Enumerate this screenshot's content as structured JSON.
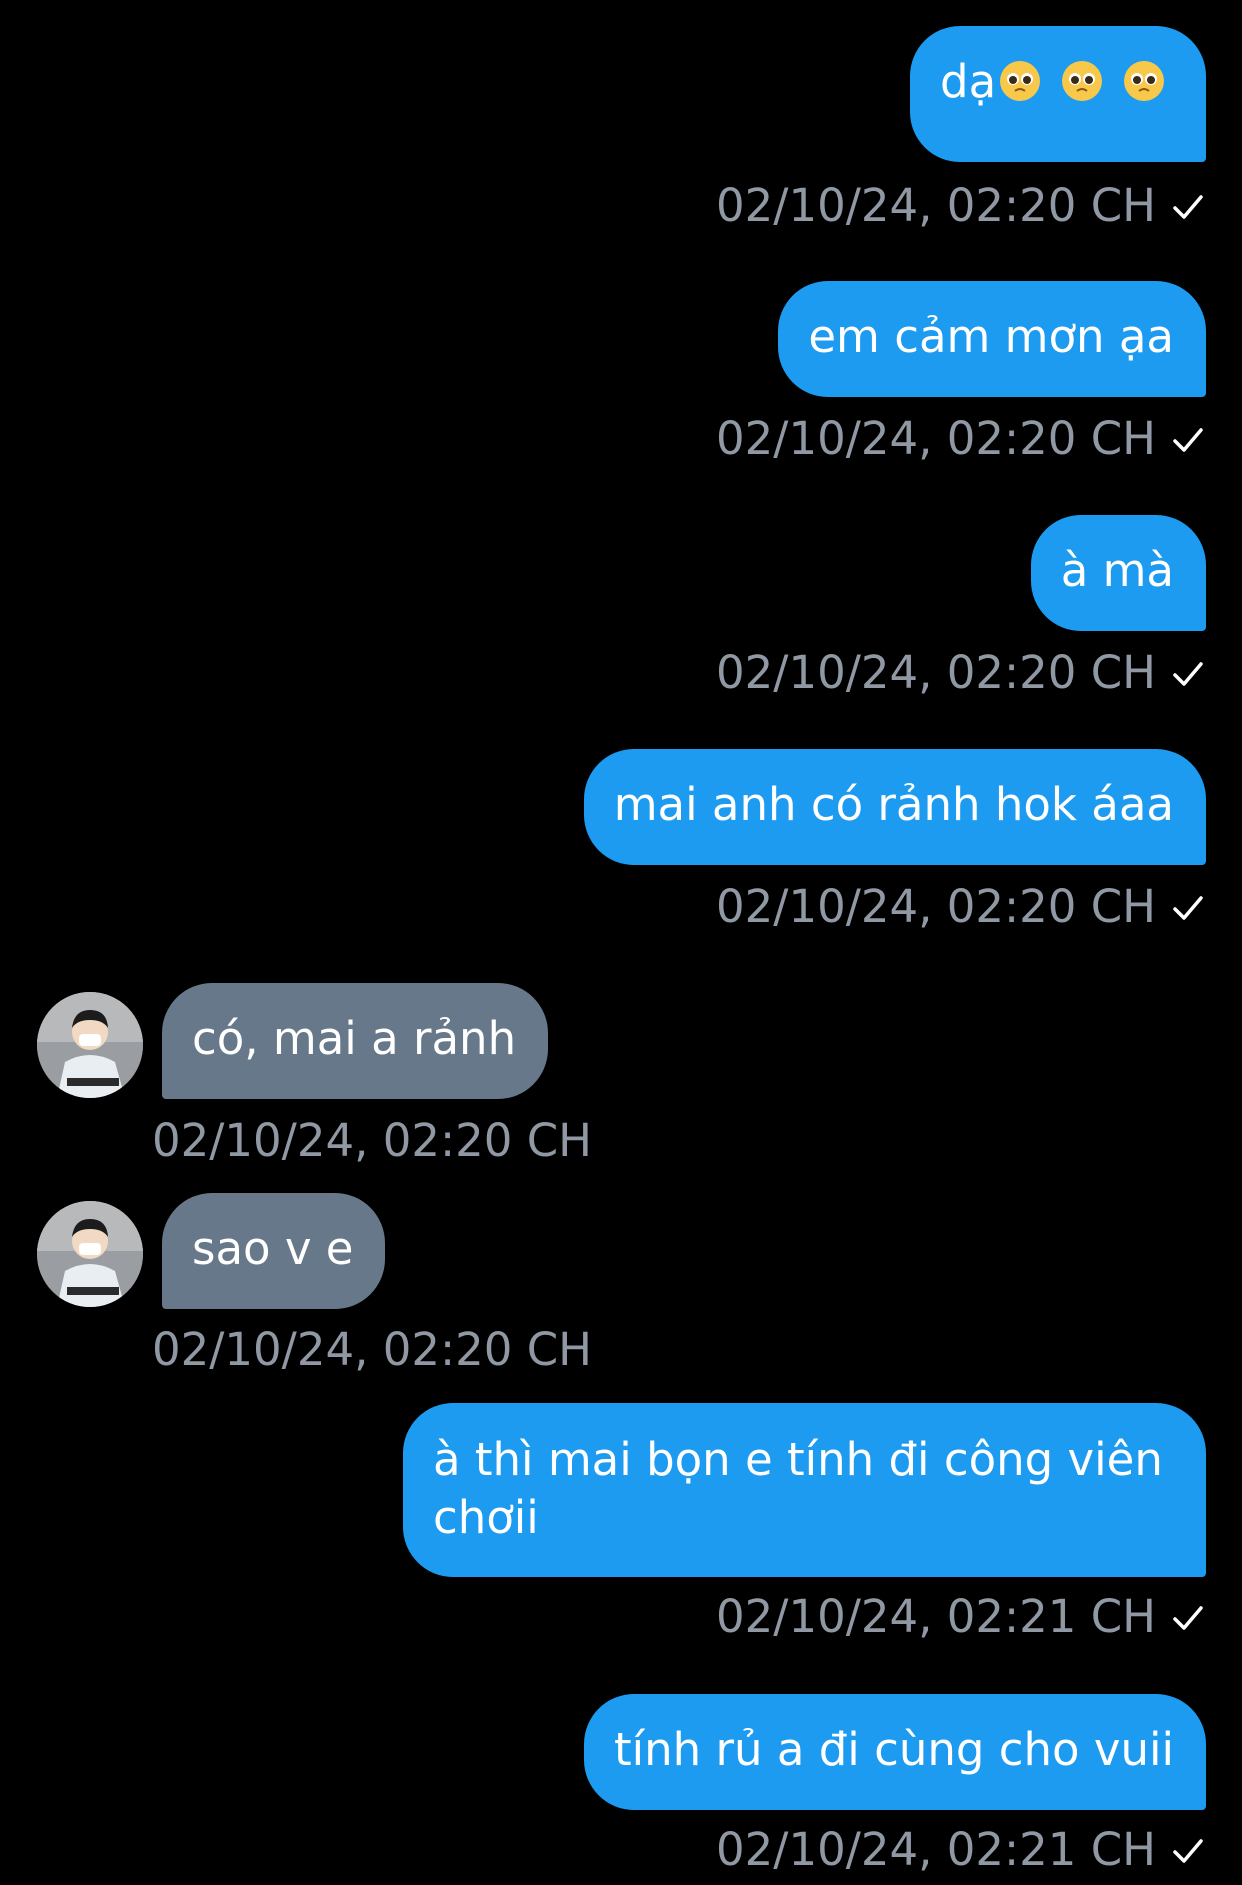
{
  "conversation": {
    "messages": [
      {
        "direction": "out",
        "text": "dạ",
        "emoji": [
          "pleading-face",
          "pleading-face",
          "pleading-face"
        ],
        "time": "02/10/24, 02:20 CH",
        "status": "sent-check"
      },
      {
        "direction": "out",
        "text": "em cảm mơn ạa",
        "time": "02/10/24, 02:20 CH",
        "status": "sent-check"
      },
      {
        "direction": "out",
        "text": "à mà",
        "time": "02/10/24, 02:20 CH",
        "status": "sent-check"
      },
      {
        "direction": "out",
        "text": "mai anh có rảnh hok áaa",
        "time": "02/10/24, 02:20 CH",
        "status": "sent-check"
      },
      {
        "direction": "in",
        "text": "có, mai a rảnh",
        "time": "02/10/24, 02:20 CH",
        "avatar": "contact-avatar"
      },
      {
        "direction": "in",
        "text": "sao v e",
        "time": "02/10/24, 02:20 CH",
        "avatar": "contact-avatar"
      },
      {
        "direction": "out",
        "text": "à thì mai bọn e tính đi công viên chơii",
        "time": "02/10/24, 02:21 CH",
        "status": "sent-check"
      },
      {
        "direction": "out",
        "text": "tính rủ a đi cùng cho vuii",
        "time": "02/10/24, 02:21 CH",
        "status": "sent-check"
      }
    ]
  },
  "colors": {
    "background": "#000000",
    "outgoing_bubble": "#1d9bf0",
    "incoming_bubble": "#67788a",
    "timestamp": "#8f98a3",
    "text": "#ffffff"
  }
}
